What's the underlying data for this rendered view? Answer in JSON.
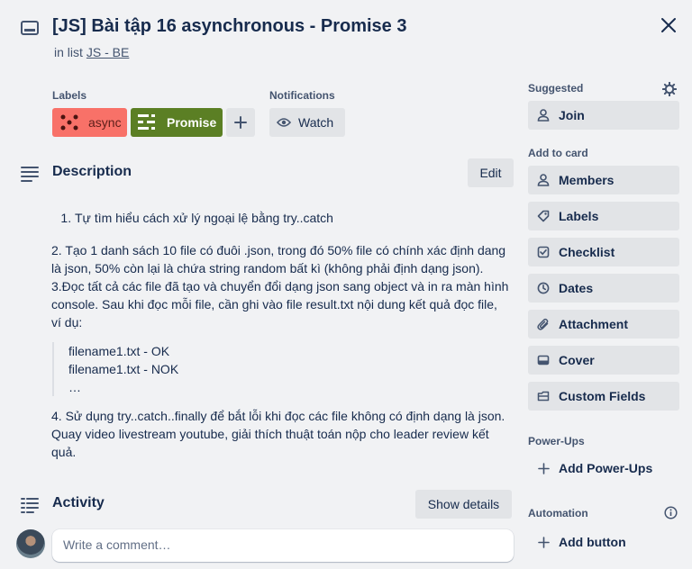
{
  "header": {
    "title": "[JS] Bài tập 16 asynchronous - Promise 3",
    "in_list_prefix": "in list",
    "list_name": "JS - BE"
  },
  "labels": {
    "heading": "Labels",
    "items": [
      {
        "text": "async",
        "color": "#f87168"
      },
      {
        "text": "Promise",
        "color": "#5b7f24"
      }
    ]
  },
  "notifications": {
    "heading": "Notifications",
    "watch_label": "Watch"
  },
  "description": {
    "heading": "Description",
    "edit_label": "Edit",
    "item1": "Tự tìm hiểu cách xử lý ngoại lệ bằng try..catch",
    "p2": "2. Tạo 1 danh sách 10 file có đuôi .json, trong đó 50% file có chính xác định dang là json, 50% còn lại là chứa string random bất kì (không phải định dạng json).",
    "p3": "3.Đọc tất cả các file đã tạo và chuyển đổi dạng json sang object và in ra màn hình console. Sau khi đọc mỗi file, cần ghi vào file result.txt nội dung kết quả đọc file, ví dụ:",
    "quote": [
      "filename1.txt - OK",
      "filename1.txt - NOK",
      "…"
    ],
    "p4": "4. Sử dụng try..catch..finally để bắt lỗi khi đọc các file không có định dạng là json. Quay video livestream youtube, giải thích thuật toán nộp cho leader review kết quả."
  },
  "activity": {
    "heading": "Activity",
    "show_details_label": "Show details",
    "comment_placeholder": "Write a comment…"
  },
  "sidebar": {
    "suggested_heading": "Suggested",
    "join_label": "Join",
    "add_to_card_heading": "Add to card",
    "add_to_card_items": [
      {
        "label": "Members",
        "icon": "person-icon"
      },
      {
        "label": "Labels",
        "icon": "tag-icon"
      },
      {
        "label": "Checklist",
        "icon": "checklist-icon"
      },
      {
        "label": "Dates",
        "icon": "clock-icon"
      },
      {
        "label": "Attachment",
        "icon": "paperclip-icon"
      },
      {
        "label": "Cover",
        "icon": "cover-icon"
      },
      {
        "label": "Custom Fields",
        "icon": "custom-fields-icon"
      }
    ],
    "powerups_heading": "Power-Ups",
    "add_powerups_label": "Add Power-Ups",
    "automation_heading": "Automation",
    "add_button_label": "Add button"
  }
}
